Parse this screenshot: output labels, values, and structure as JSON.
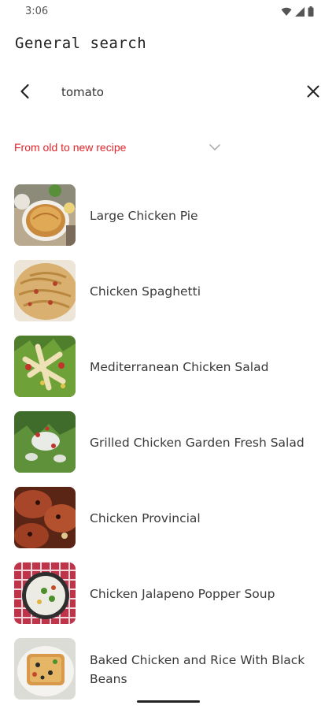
{
  "status_bar": {
    "time": "3:06",
    "icons": [
      "wifi-icon",
      "cell-signal-icon",
      "battery-icon"
    ]
  },
  "header": {
    "title": "General search"
  },
  "search": {
    "value": "tomato",
    "back_icon": "chevron-left-icon",
    "clear_icon": "close-icon"
  },
  "sort": {
    "label": "From old to new recipe",
    "icon": "chevron-down-icon",
    "color": "#e0262b"
  },
  "recipes": [
    {
      "name": "Large Chicken Pie"
    },
    {
      "name": "Chicken Spaghetti"
    },
    {
      "name": "Mediterranean Chicken Salad"
    },
    {
      "name": "Grilled Chicken Garden Fresh Salad"
    },
    {
      "name": "Chicken Provincial"
    },
    {
      "name": "Chicken Jalapeno Popper Soup"
    },
    {
      "name": "Baked Chicken and Rice With Black Beans"
    }
  ]
}
